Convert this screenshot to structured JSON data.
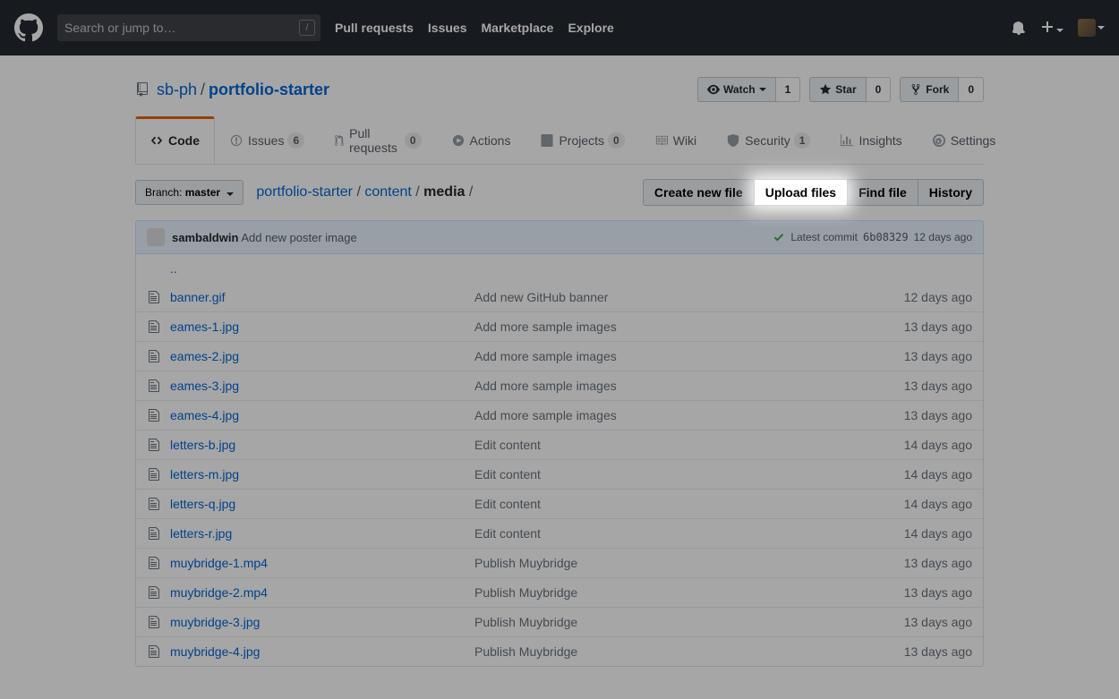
{
  "header": {
    "search_placeholder": "Search or jump to…",
    "nav": [
      "Pull requests",
      "Issues",
      "Marketplace",
      "Explore"
    ]
  },
  "repo": {
    "owner": "sb-ph",
    "name": "portfolio-starter",
    "watch": {
      "label": "Watch",
      "count": "1"
    },
    "star": {
      "label": "Star",
      "count": "0"
    },
    "fork": {
      "label": "Fork",
      "count": "0"
    }
  },
  "tabs": {
    "code": "Code",
    "issues": {
      "label": "Issues",
      "count": "6"
    },
    "pulls": {
      "label": "Pull requests",
      "count": "0"
    },
    "actions": "Actions",
    "projects": {
      "label": "Projects",
      "count": "0"
    },
    "wiki": "Wiki",
    "security": {
      "label": "Security",
      "count": "1"
    },
    "insights": "Insights",
    "settings": "Settings"
  },
  "branch": {
    "prefix": "Branch:",
    "name": "master"
  },
  "breadcrumb": {
    "root": "portfolio-starter",
    "p1": "content",
    "current": "media"
  },
  "file_buttons": {
    "create": "Create new file",
    "upload": "Upload files",
    "find": "Find file",
    "history": "History"
  },
  "commit": {
    "author": "sambaldwin",
    "message": "Add new poster image",
    "latest_label": "Latest commit",
    "hash": "6b08329",
    "age": "12 days ago"
  },
  "up_dir": "..",
  "files": [
    {
      "name": "banner.gif",
      "msg": "Add new GitHub banner",
      "age": "12 days ago"
    },
    {
      "name": "eames-1.jpg",
      "msg": "Add more sample images",
      "age": "13 days ago"
    },
    {
      "name": "eames-2.jpg",
      "msg": "Add more sample images",
      "age": "13 days ago"
    },
    {
      "name": "eames-3.jpg",
      "msg": "Add more sample images",
      "age": "13 days ago"
    },
    {
      "name": "eames-4.jpg",
      "msg": "Add more sample images",
      "age": "13 days ago"
    },
    {
      "name": "letters-b.jpg",
      "msg": "Edit content",
      "age": "14 days ago"
    },
    {
      "name": "letters-m.jpg",
      "msg": "Edit content",
      "age": "14 days ago"
    },
    {
      "name": "letters-q.jpg",
      "msg": "Edit content",
      "age": "14 days ago"
    },
    {
      "name": "letters-r.jpg",
      "msg": "Edit content",
      "age": "14 days ago"
    },
    {
      "name": "muybridge-1.mp4",
      "msg": "Publish Muybridge",
      "age": "13 days ago"
    },
    {
      "name": "muybridge-2.mp4",
      "msg": "Publish Muybridge",
      "age": "13 days ago"
    },
    {
      "name": "muybridge-3.jpg",
      "msg": "Publish Muybridge",
      "age": "13 days ago"
    },
    {
      "name": "muybridge-4.jpg",
      "msg": "Publish Muybridge",
      "age": "13 days ago"
    }
  ]
}
